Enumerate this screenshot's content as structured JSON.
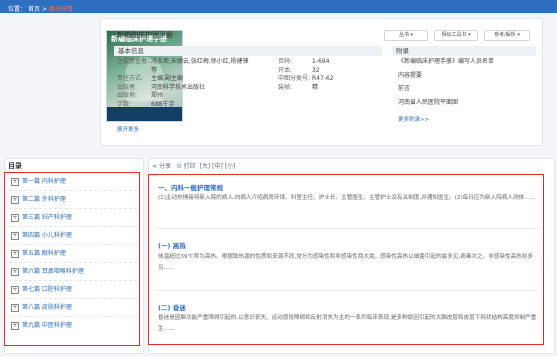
{
  "breadcrumb": {
    "label": "位置：",
    "home": "首页",
    "current": "图书详情"
  },
  "book": {
    "title": "新编临床护理手册",
    "cover_title": "新编临床护理手册",
    "actions": [
      "丛书",
      "相似工具书",
      "参考/解析"
    ]
  },
  "basic_info": {
    "heading": "基本信息",
    "left": [
      {
        "k": "主要责任者:",
        "v": "冯玉荣,宋德云,张红梅,徐小红,杨建锋"
      },
      {
        "k": "",
        "v": "等"
      },
      {
        "k": "责任方式:",
        "v": "主编,副主编"
      },
      {
        "k": "出版者:",
        "v": "河南科学技术出版社"
      },
      {
        "k": "出版地:",
        "v": "郑州"
      },
      {
        "k": "字数:",
        "v": "688千字"
      }
    ],
    "right": [
      {
        "k": "页码:",
        "v": "1-694"
      },
      {
        "k": "开本:",
        "v": "32"
      },
      {
        "k": "中图分类号:",
        "v": "R47-62"
      },
      {
        "k": "装帧:",
        "v": "精"
      }
    ],
    "expand": "展开更多"
  },
  "attachments": {
    "heading": "附录",
    "items": [
      "《新编临床护理手册》编写人员名单",
      "内容提要",
      "前言",
      "河南省人民医院平面图"
    ],
    "more": "更多附录>>"
  },
  "toc": {
    "title": "目录",
    "items": [
      "第一篇 内科护理",
      "第二篇 外科护理",
      "第三篇 妇产科护理",
      "第四篇 小儿科护理",
      "第五篇 眼科护理",
      "第六篇 耳鼻咽喉科护理",
      "第七篇 口腔科护理",
      "第八篇 皮肤科护理",
      "第九篇 中医科护理"
    ]
  },
  "toolbar": {
    "share": "分享",
    "print": "打印",
    "font_large": "[大]",
    "font_mid": "[中]",
    "font_small": "[小]"
  },
  "content": {
    "sections": [
      {
        "heading": "一、内科一般护理常规",
        "text": "(1)主动热情接待新入院的病人,向病人介绍病房环境、科室主任、护士长、主管医生、主管护士及有关制度,并通知医生。(2)每日应为新入院病人测体......"
      },
      {
        "heading": "(一) 高热",
        "text": "体温超过39℃称为高热。根据致热源的性质和来源不同,常分为感染性和非感染性两大类。感染性高热以细菌引起的最多见,病毒次之。非感染性高热则多见......"
      },
      {
        "heading": "(二) 昏迷",
        "text": "昏迷是因脑功能严重障碍引起的,以意识丧失、运动感觉障碍和反射消失为主的一系列临床表现,是多种原因引起的大脑皮层和皮层下网状结构高度抑制严重生......"
      }
    ]
  }
}
